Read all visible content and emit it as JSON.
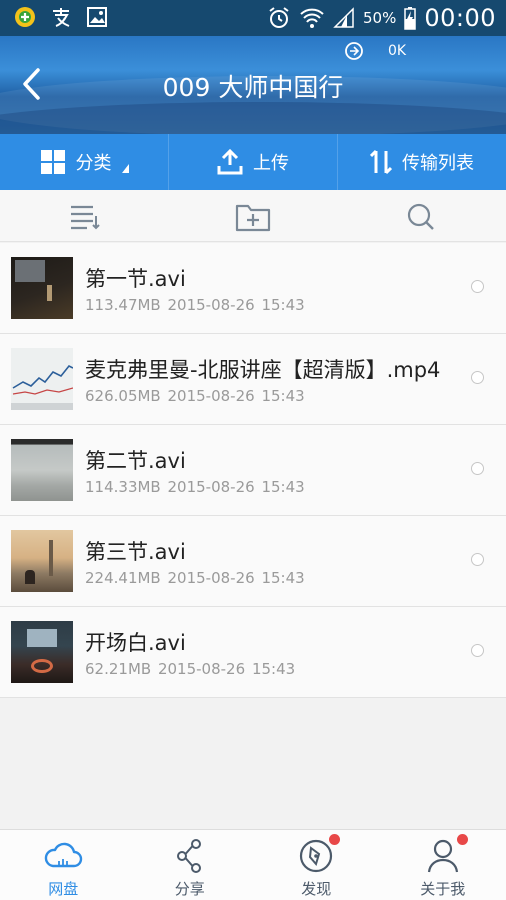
{
  "status_bar": {
    "battery_percent": "50%",
    "time": "00:00"
  },
  "header": {
    "title": "009 大师中国行",
    "traffic_speed": "0K"
  },
  "toolbar": {
    "category_label": "分类",
    "upload_label": "上传",
    "transfer_label": "传输列表"
  },
  "files": [
    {
      "name": "第一节.avi",
      "size": "113.47MB",
      "date": "2015-08-26",
      "time": "15:43"
    },
    {
      "name": "麦克弗里曼-北服讲座【超清版】.mp4",
      "size": "626.05MB",
      "date": "2015-08-26",
      "time": "15:43"
    },
    {
      "name": "第二节.avi",
      "size": "114.33MB",
      "date": "2015-08-26",
      "time": "15:43"
    },
    {
      "name": "第三节.avi",
      "size": "224.41MB",
      "date": "2015-08-26",
      "time": "15:43"
    },
    {
      "name": "开场白.avi",
      "size": "62.21MB",
      "date": "2015-08-26",
      "time": "15:43"
    }
  ],
  "bottom_nav": {
    "items": [
      {
        "label": "网盘",
        "icon": "cloud-icon"
      },
      {
        "label": "分享",
        "icon": "share-icon"
      },
      {
        "label": "发现",
        "icon": "compass-icon"
      },
      {
        "label": "关于我",
        "icon": "person-icon"
      }
    ]
  },
  "colors": {
    "accent": "#2f8de4",
    "badge": "#e84848",
    "status_bar": "#16496f"
  }
}
